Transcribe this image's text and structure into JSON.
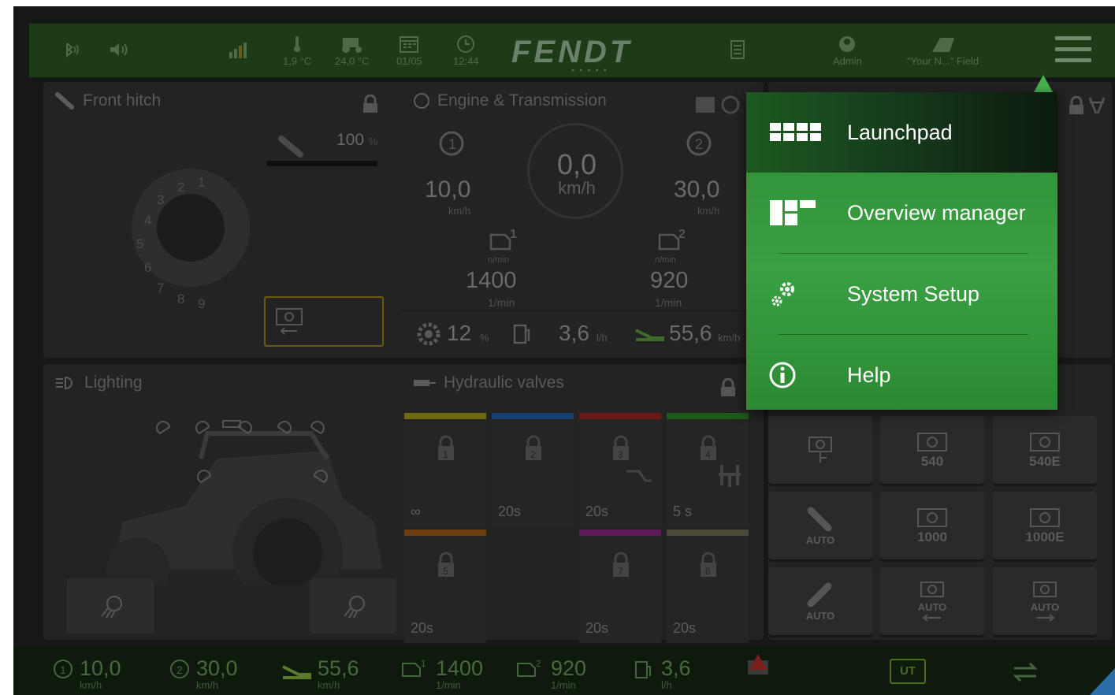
{
  "topbar": {
    "temp_outside": "1,9 °C",
    "temp_cab": "24,0 °C",
    "date": "01/05",
    "time": "12:44",
    "brand": "FENDT",
    "user": "Admin",
    "field": "\"Your N...\" Field"
  },
  "front_hitch": {
    "title": "Front hitch",
    "percent_value": "100",
    "percent_unit": "%",
    "dial_numbers": [
      "1",
      "2",
      "3",
      "4",
      "5",
      "6",
      "7",
      "8",
      "9"
    ]
  },
  "engine": {
    "title": "Engine & Transmission",
    "range1_speed": "10,0",
    "range1_unit": "km/h",
    "range2_speed": "30,0",
    "range2_unit": "km/h",
    "speed": "0,0",
    "speed_unit": "km/h",
    "engine1_rpm": "1400",
    "engine1_unit": "1/min",
    "engine1_label": "n/min",
    "engine2_rpm": "920",
    "engine2_unit": "1/min",
    "engine2_label": "n/min",
    "slip": "12",
    "slip_unit": "%",
    "fuel": "3,6",
    "fuel_unit": "l/h",
    "ground_speed": "55,6",
    "ground_speed_unit": "km/h"
  },
  "lighting": {
    "title": "Lighting"
  },
  "hydraulics": {
    "title": "Hydraulic valves",
    "valves": [
      {
        "num": "1",
        "time": "∞",
        "color": "#6f6a12"
      },
      {
        "num": "2",
        "time": "20s",
        "color": "#17426e"
      },
      {
        "num": "3",
        "time": "20s",
        "color": "#6b1818"
      },
      {
        "num": "4",
        "time": "5 s",
        "color": "#1e5a1e"
      },
      {
        "num": "5",
        "time": "20s",
        "color": "#6e3e0e"
      },
      {
        "num": "7",
        "time": "20s",
        "color": "#5e1a5a"
      },
      {
        "num": "8",
        "time": "20s",
        "color": "#4b4a3a"
      }
    ]
  },
  "pto": {
    "buttons": [
      "",
      "540",
      "540E",
      "AUTO",
      "1000",
      "1000E",
      "AUTO",
      "AUTO",
      "AUTO"
    ]
  },
  "bottombar": {
    "range1": "10,0",
    "range1_unit": "km/h",
    "range2": "30,0",
    "range2_unit": "km/h",
    "ground": "55,6",
    "ground_unit": "km/h",
    "eng1": "1400",
    "eng1_unit": "1/min",
    "eng2": "920",
    "eng2_unit": "1/min",
    "fuel": "3,6",
    "fuel_unit": "l/h",
    "ut_label": "UT"
  },
  "menu": {
    "items": [
      {
        "label": "Launchpad",
        "icon": "launchpad-icon"
      },
      {
        "label": "Overview manager",
        "icon": "overview-icon"
      },
      {
        "label": "System Setup",
        "icon": "gears-icon"
      },
      {
        "label": "Help",
        "icon": "info-icon"
      }
    ],
    "active_index": 0
  }
}
